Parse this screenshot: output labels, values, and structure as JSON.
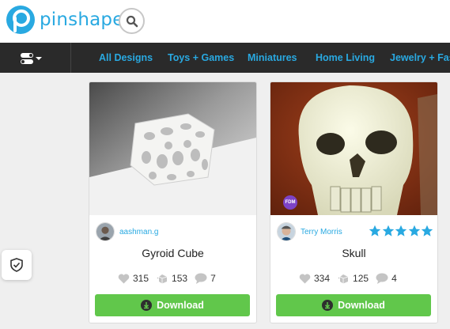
{
  "header": {
    "logo_text": "pinshape",
    "logo_icon": "pinshape-logo-icon",
    "search_icon": "search-icon"
  },
  "nav": {
    "toggle_icon": "toggle-menu-icon",
    "items": [
      {
        "label": "All Designs"
      },
      {
        "label": "Toys + Games"
      },
      {
        "label": "Miniatures"
      },
      {
        "label": "Home Living"
      },
      {
        "label": "Jewelry + Fash"
      }
    ]
  },
  "cards": [
    {
      "designer": "aashman.g",
      "title": "Gyroid Cube",
      "likes": "315",
      "makes": "153",
      "comments": "7",
      "download_label": "Download",
      "rating_stars": 0
    },
    {
      "designer": "Terry Morris",
      "title": "Skull",
      "likes": "334",
      "makes": "125",
      "comments": "4",
      "download_label": "Download",
      "rating_stars": 5,
      "badge": "FDM"
    }
  ],
  "colors": {
    "brand": "#29a9e1",
    "nav_bg": "#2a2a2a",
    "download": "#61c74b",
    "badge": "#7d43c7"
  },
  "floating": {
    "shield_icon": "shield-check-icon"
  }
}
